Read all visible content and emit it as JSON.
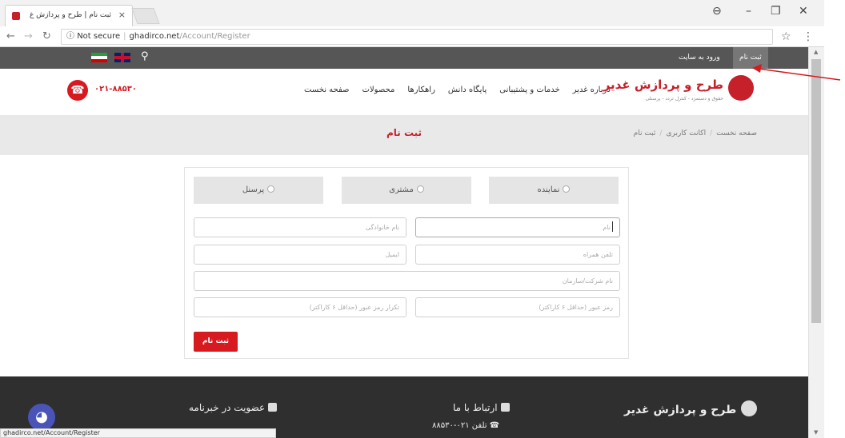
{
  "browser": {
    "tab_title": "ثبت نام | طرح و پردازش غ",
    "tab_close": "×",
    "url_host": "Not secure",
    "url_domain": "ghadirco.net",
    "url_path": "/Account/Register",
    "status_url": "ghadirco.net/Account/Register"
  },
  "topbar": {
    "login_label": "ورود به سایت",
    "register_label": "ثبت نام"
  },
  "header": {
    "phone": "۰۲۱-۸۸۵۳۰",
    "nav": [
      "صفحه نخست",
      "محصولات",
      "راهکارها",
      "پایگاه دانش",
      "خدمات و پشتیبانی",
      "درباره غدیر"
    ],
    "logo_name": "طرح و پردازش غدیر",
    "logo_tagline": "حقوق و دستمزد - کنترل تردد - پرسنلی"
  },
  "titlebar": {
    "title": "ثبت نام",
    "breadcrumb": [
      "صفحه نخست",
      "اکانت کاربری",
      "ثبت نام"
    ]
  },
  "form": {
    "roles": [
      "نماینده",
      "مشتری",
      "پرسنل"
    ],
    "first_name_placeholder": "نام",
    "last_name_placeholder": "نام خانوادگی",
    "mobile_placeholder": "تلفن همراه",
    "email_placeholder": "ایمیل",
    "company_placeholder": "نام شرکت/سازمان",
    "password_placeholder": "رمز عبور (حداقل ۶ کاراکتر)",
    "password_repeat_placeholder": "تکرار رمز عبور (حداقل ۶ کاراکتر)",
    "submit_label": "ثبت نام"
  },
  "footer": {
    "logo_name": "طرح و پردازش غدیر",
    "contact_heading": "ارتباط با ما",
    "phone_label": "تلفن",
    "phone_value": "۰۲۱-۸۸۵۳۰",
    "newsletter_heading": "عضویت در خبرنامه"
  },
  "colors": {
    "brand_red": "#c6202b",
    "topbar_gray": "#565656",
    "footer_dark": "#2f2f2f"
  }
}
